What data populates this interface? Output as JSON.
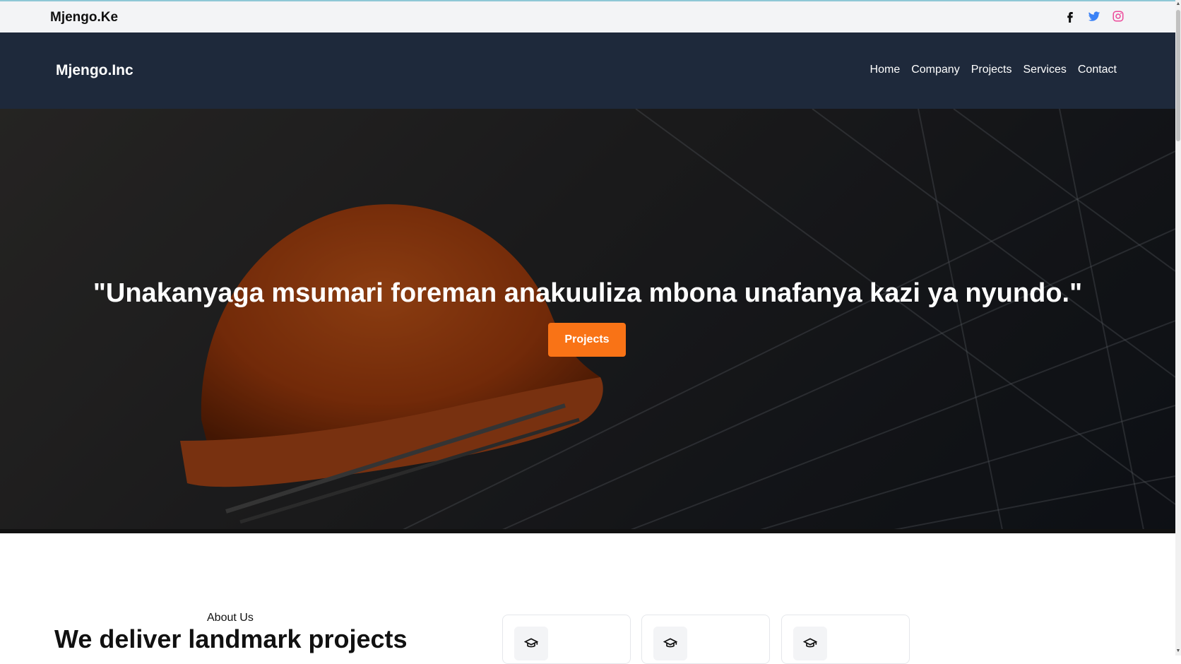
{
  "topbar": {
    "brand": "Mjengo.Ke",
    "socials": [
      {
        "icon": "facebook-icon",
        "color": "#111111"
      },
      {
        "icon": "twitter-icon",
        "color": "#3b82f6"
      },
      {
        "icon": "instagram-icon",
        "color": "#ec4899"
      }
    ]
  },
  "navbar": {
    "logo": "Mjengo.Inc",
    "links": [
      "Home",
      "Company",
      "Projects",
      "Services",
      "Contact"
    ]
  },
  "hero": {
    "quote": "\"Unakanyaga msumari foreman anakuuliza mbona unafanya kazi ya nyundo.\"",
    "cta_label": "Projects",
    "cta_color": "#f97316"
  },
  "about": {
    "label": "About Us",
    "heading": "We deliver landmark projects"
  },
  "features": [
    {
      "icon": "graduation-cap-icon"
    },
    {
      "icon": "graduation-cap-icon"
    },
    {
      "icon": "graduation-cap-icon"
    }
  ]
}
